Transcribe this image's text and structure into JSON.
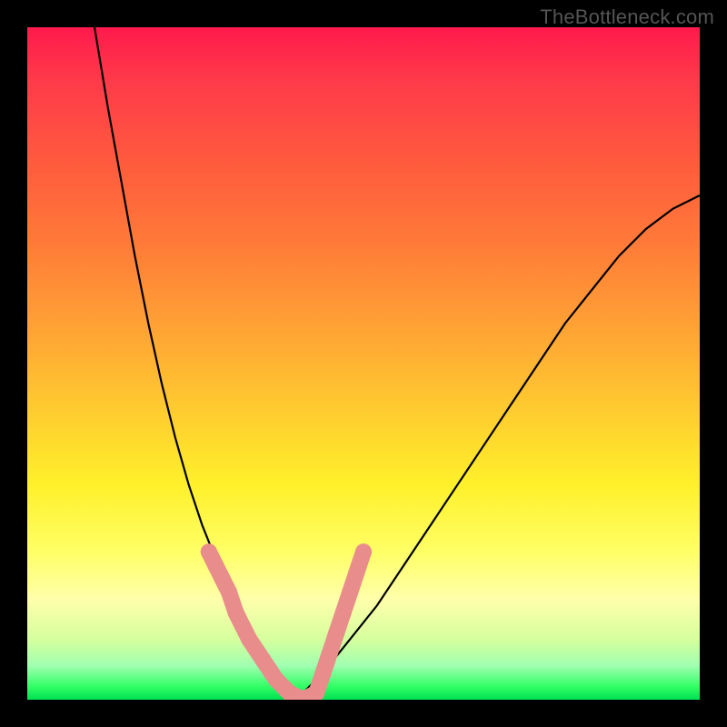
{
  "watermark_text": "TheBottleneck.com",
  "colors": {
    "page_bg": "#000000",
    "curve_stroke": "#000000",
    "marker_fill": "#e98c8c",
    "watermark_color": "#555555"
  },
  "chart_data": {
    "type": "line",
    "title": "",
    "xlabel": "",
    "ylabel": "",
    "xlim": [
      0,
      100
    ],
    "ylim": [
      0,
      100
    ],
    "note": "V-shaped bottleneck curve; y=0 is at bottom (green), y=100 at top (red). Curve minimum near x≈40.",
    "series": [
      {
        "name": "left-branch",
        "x": [
          10,
          12,
          14,
          16,
          18,
          20,
          22,
          24,
          26,
          28,
          30,
          32,
          34,
          36,
          38,
          40
        ],
        "values": [
          100,
          88,
          77,
          66,
          56,
          47,
          39,
          32,
          26,
          21,
          16,
          12,
          8,
          5,
          2,
          0
        ]
      },
      {
        "name": "right-branch",
        "x": [
          40,
          44,
          48,
          52,
          56,
          60,
          64,
          68,
          72,
          76,
          80,
          84,
          88,
          92,
          96,
          100
        ],
        "values": [
          0,
          4,
          9,
          14,
          20,
          26,
          32,
          38,
          44,
          50,
          56,
          61,
          66,
          70,
          73,
          75
        ]
      }
    ],
    "markers": {
      "name": "highlighted-range",
      "description": "sausage-style pink markers along curve near minimum, approx x 27–50, y 0–22",
      "points_xy": [
        [
          27,
          22
        ],
        [
          28,
          20
        ],
        [
          29,
          18
        ],
        [
          30,
          16
        ],
        [
          31,
          13
        ],
        [
          32,
          11
        ],
        [
          33,
          9
        ],
        [
          35,
          6
        ],
        [
          37,
          3
        ],
        [
          39,
          1
        ],
        [
          41,
          0
        ],
        [
          43,
          1
        ],
        [
          44,
          4
        ],
        [
          45,
          7
        ],
        [
          46,
          10
        ],
        [
          47,
          13
        ],
        [
          48,
          16
        ],
        [
          49,
          19
        ],
        [
          50,
          22
        ]
      ]
    },
    "gradient_stops": [
      {
        "pos": 0.0,
        "color": "#ff1a4c"
      },
      {
        "pos": 0.08,
        "color": "#ff3a4a"
      },
      {
        "pos": 0.2,
        "color": "#ff5a3e"
      },
      {
        "pos": 0.32,
        "color": "#ff7a38"
      },
      {
        "pos": 0.44,
        "color": "#ffa035"
      },
      {
        "pos": 0.56,
        "color": "#ffc830"
      },
      {
        "pos": 0.68,
        "color": "#fff02a"
      },
      {
        "pos": 0.78,
        "color": "#ffff66"
      },
      {
        "pos": 0.85,
        "color": "#ffffaa"
      },
      {
        "pos": 0.91,
        "color": "#d6ff9e"
      },
      {
        "pos": 0.95,
        "color": "#9fffb0"
      },
      {
        "pos": 0.98,
        "color": "#33ff66"
      },
      {
        "pos": 1.0,
        "color": "#00e050"
      }
    ]
  }
}
